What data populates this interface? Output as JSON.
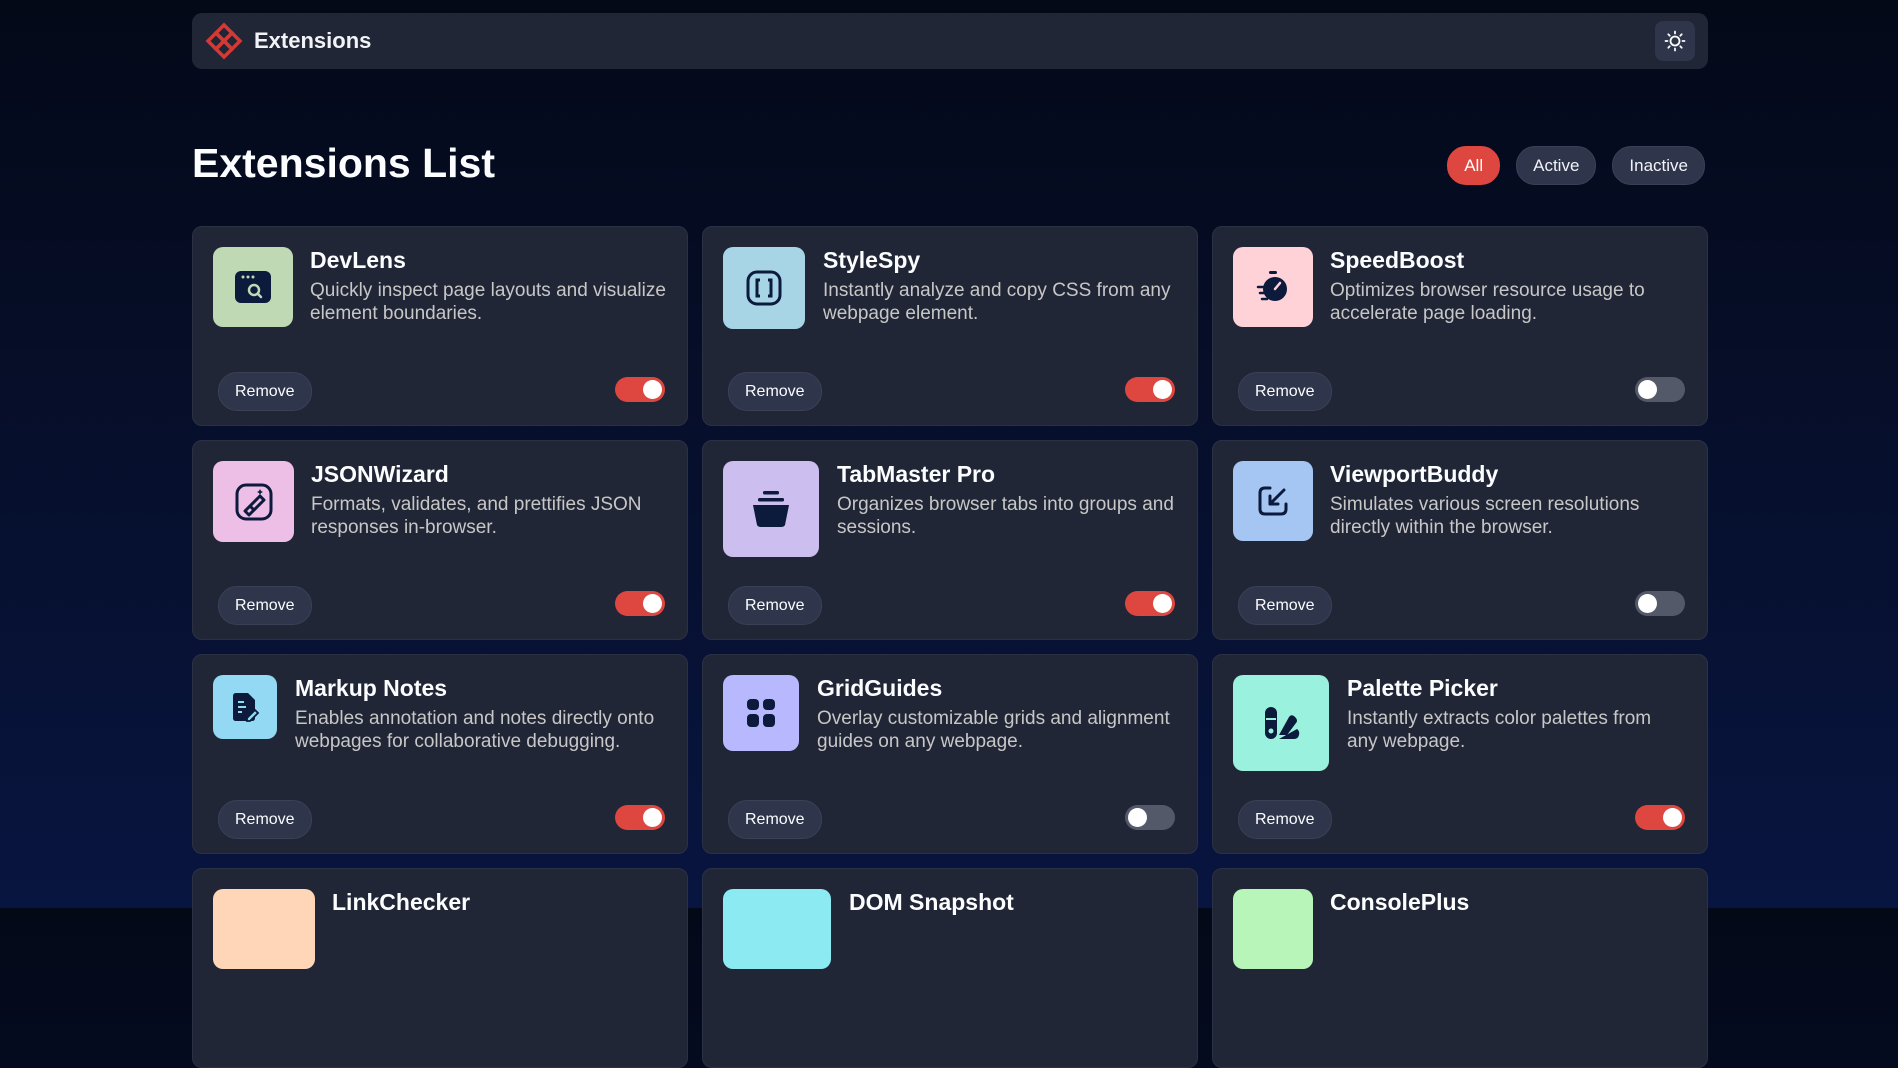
{
  "header": {
    "brand": "Extensions",
    "icons": {
      "logo": "logo-icon",
      "theme": "sun-icon"
    }
  },
  "page": {
    "title": "Extensions List"
  },
  "filters": [
    {
      "label": "All",
      "active": true
    },
    {
      "label": "Active",
      "active": false
    },
    {
      "label": "Inactive",
      "active": false
    }
  ],
  "remove_label": "Remove",
  "colors": {
    "accent": "#de473f",
    "card": "#212636",
    "toggle_off": "#545969"
  },
  "extensions": [
    {
      "name": "DevLens",
      "description": "Quickly inspect page layouts and visualize element boundaries.",
      "active": true,
      "icon": "devlens-icon",
      "icon_bg": "#bed9b4"
    },
    {
      "name": "StyleSpy",
      "description": "Instantly analyze and copy CSS from any webpage element.",
      "active": true,
      "icon": "stylespy-icon",
      "icon_bg": "#a7d5e6"
    },
    {
      "name": "SpeedBoost",
      "description": "Optimizes browser resource usage to accelerate page loading.",
      "active": false,
      "icon": "speedboost-icon",
      "icon_bg": "#ffd2d8"
    },
    {
      "name": "JSONWizard",
      "description": "Formats, validates, and prettifies JSON responses in-browser.",
      "active": true,
      "icon": "jsonwizard-icon",
      "icon_bg": "#eebfe6"
    },
    {
      "name": "TabMaster Pro",
      "description": "Organizes browser tabs into groups and sessions.",
      "active": true,
      "icon": "tabmaster-icon",
      "icon_bg": "#ccbfef"
    },
    {
      "name": "ViewportBuddy",
      "description": "Simulates various screen resolutions directly within the browser.",
      "active": false,
      "icon": "viewportbuddy-icon",
      "icon_bg": "#a5c6f3"
    },
    {
      "name": "Markup Notes",
      "description": "Enables annotation and notes directly onto webpages for collaborative debugging.",
      "active": true,
      "icon": "markupnotes-icon",
      "icon_bg": "#93d9f3"
    },
    {
      "name": "GridGuides",
      "description": "Overlay customizable grids and alignment guides on any webpage.",
      "active": false,
      "icon": "gridguides-icon",
      "icon_bg": "#b8b8ff"
    },
    {
      "name": "Palette Picker",
      "description": "Instantly extracts color palettes from any webpage.",
      "active": true,
      "icon": "palettepicker-icon",
      "icon_bg": "#9af2de"
    },
    {
      "name": "LinkChecker",
      "description": "",
      "active": true,
      "icon": "linkchecker-icon",
      "icon_bg": "#ffd7b8"
    },
    {
      "name": "DOM Snapshot",
      "description": "",
      "active": false,
      "icon": "domsnapshot-icon",
      "icon_bg": "#8beaf2"
    },
    {
      "name": "ConsolePlus",
      "description": "",
      "active": true,
      "icon": "consoleplus-icon",
      "icon_bg": "#b8f5b8"
    }
  ]
}
